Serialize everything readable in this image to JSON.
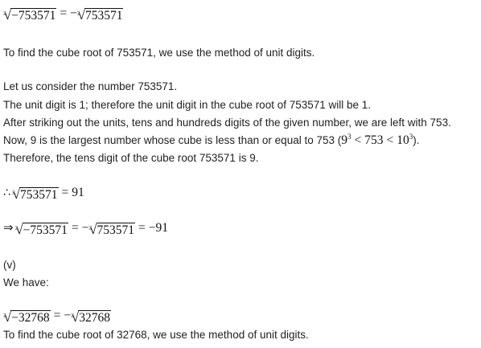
{
  "eq1": {
    "index": "3",
    "left_radicand": "−753571",
    "equals": "=",
    "neg": "−",
    "right_radicand": "753571"
  },
  "p1": "To find the cube root of 753571, we use the method of unit digits.",
  "p2": "Let us consider the number 753571.",
  "p3": "The unit digit is 1; therefore the unit digit in the cube root of 753571 will be 1.",
  "p4": "After striking out the units, tens and hundreds digits of the given number, we are left with 753.",
  "p5": {
    "text": "Now, 9 is the largest number whose cube is less than or equal to 753 (",
    "base1": "9",
    "exp1": "3",
    "lt1": "<",
    "mid": "753",
    "lt2": "<",
    "base2": "10",
    "exp2": "3",
    "close": ")."
  },
  "p6": "Therefore, the tens digit of the cube root 753571 is 9.",
  "eq2": {
    "symbol": "∴",
    "index": "3",
    "radicand": "753571",
    "equals": "=",
    "result": "91"
  },
  "eq3": {
    "symbol": "⇒",
    "index": "3",
    "radicand1": "−753571",
    "eq1": "=",
    "neg": "−",
    "radicand2": "753571",
    "eq2": "=",
    "result": "−91"
  },
  "part_label": "(v)",
  "we_have": "We have:",
  "eq4": {
    "index": "3",
    "left_radicand": "−32768",
    "equals": "=",
    "neg": "−",
    "right_radicand": "32768"
  },
  "p7": "To find the cube root of 32768, we use the method of unit digits."
}
